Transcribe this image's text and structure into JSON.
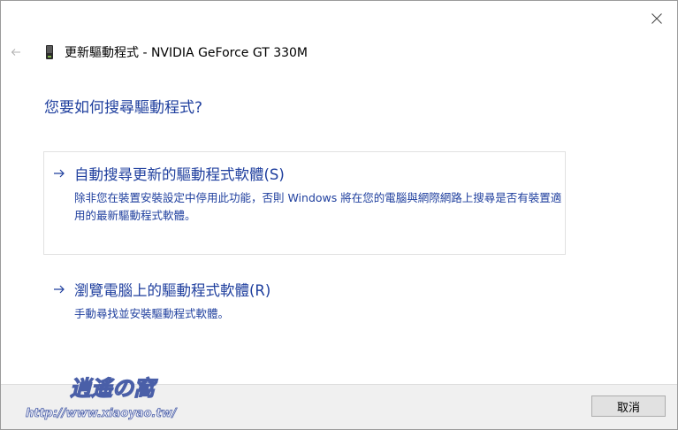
{
  "window": {
    "title": "更新驅動程式 - NVIDIA GeForce GT 330M",
    "icons": {
      "back": "back-arrow-icon",
      "close": "close-icon",
      "device": "device-icon"
    }
  },
  "question": "您要如何搜尋驅動程式?",
  "options": [
    {
      "title": "自動搜尋更新的驅動程式軟體(S)",
      "description": "除非您在裝置安裝設定中停用此功能，否則 Windows 將在您的電腦與網際網路上搜尋是否有裝置適用的最新驅動程式軟體。"
    },
    {
      "title": "瀏覽電腦上的驅動程式軟體(R)",
      "description": "手動尋找並安裝驅動程式軟體。"
    }
  ],
  "footer": {
    "cancel_label": "取消"
  },
  "watermark": {
    "name": "逍遙の窩",
    "url": "http://www.xiaoyao.tw/"
  },
  "colors": {
    "link": "#1f3f9e",
    "footer_bg": "#f0f0f0"
  }
}
